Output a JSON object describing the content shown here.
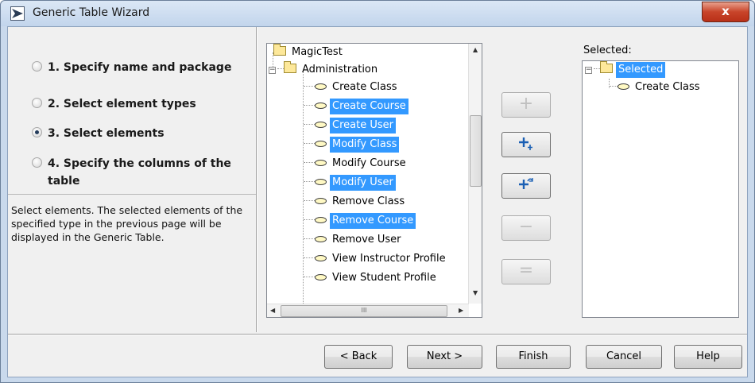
{
  "window": {
    "title": "Generic Table Wizard",
    "close_glyph": "x"
  },
  "steps": [
    {
      "label": "1. Specify name and package",
      "checked": false
    },
    {
      "label": "2. Select element types",
      "checked": false
    },
    {
      "label": "3. Select elements",
      "checked": true
    },
    {
      "label": "4. Specify the columns of the table",
      "checked": false
    }
  ],
  "description": "Select elements. The selected elements of the specified type in the previous page will be displayed in the Generic Table.",
  "tree": {
    "root": "MagicTest",
    "group": "Administration",
    "items": [
      {
        "label": "Create Class",
        "selected": false
      },
      {
        "label": "Create Course",
        "selected": true
      },
      {
        "label": "Create User",
        "selected": true
      },
      {
        "label": "Modify Class",
        "selected": true
      },
      {
        "label": "Modify Course",
        "selected": false
      },
      {
        "label": "Modify User",
        "selected": true
      },
      {
        "label": "Remove Class",
        "selected": false
      },
      {
        "label": "Remove Course",
        "selected": true
      },
      {
        "label": "Remove User",
        "selected": false
      },
      {
        "label": "View Instructor Profile",
        "selected": false
      },
      {
        "label": "View Student Profile",
        "selected": false
      }
    ],
    "scroll_thumb_glyph": "III"
  },
  "middle_buttons": [
    {
      "name": "add-button",
      "glyph": "+",
      "enabled": false
    },
    {
      "name": "add-all-button",
      "glyph": "+",
      "enabled": true
    },
    {
      "name": "add-recursive-button",
      "glyph": "+",
      "enabled": true
    },
    {
      "name": "remove-button",
      "glyph": "−",
      "enabled": false
    },
    {
      "name": "remove-all-button",
      "glyph": "=",
      "enabled": false
    }
  ],
  "selected": {
    "label": "Selected:",
    "root": "Selected",
    "items": [
      "Create Class"
    ]
  },
  "buttons": {
    "back": "< Back",
    "next": "Next >",
    "finish": "Finish",
    "cancel": "Cancel",
    "help": "Help"
  },
  "colors": {
    "selection": "#3399ff",
    "accent": "#1a5fb4"
  }
}
